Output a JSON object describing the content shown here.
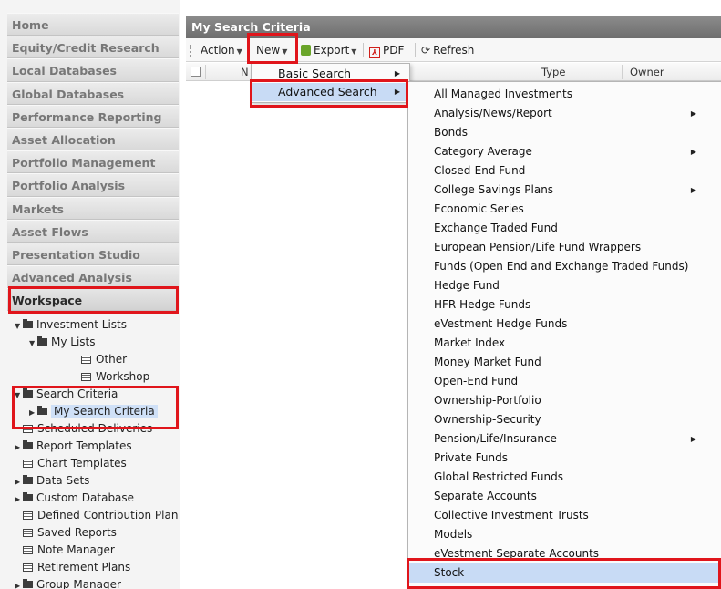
{
  "sidebar": {
    "nav_items": [
      {
        "label": "Home",
        "name": "nav-home"
      },
      {
        "label": "Equity/Credit Research",
        "name": "nav-equity-credit-research"
      },
      {
        "label": "Local Databases",
        "name": "nav-local-databases"
      },
      {
        "label": "Global Databases",
        "name": "nav-global-databases"
      },
      {
        "label": "Performance Reporting",
        "name": "nav-performance-reporting"
      },
      {
        "label": "Asset Allocation",
        "name": "nav-asset-allocation"
      },
      {
        "label": "Portfolio Management",
        "name": "nav-portfolio-management"
      },
      {
        "label": "Portfolio Analysis",
        "name": "nav-portfolio-analysis"
      },
      {
        "label": "Markets",
        "name": "nav-markets"
      },
      {
        "label": "Asset Flows",
        "name": "nav-asset-flows"
      },
      {
        "label": "Presentation Studio",
        "name": "nav-presentation-studio"
      },
      {
        "label": "Advanced Analysis",
        "name": "nav-advanced-analysis"
      },
      {
        "label": "Workspace",
        "name": "nav-workspace",
        "selected": true
      }
    ],
    "tree": [
      {
        "label": "Investment Lists",
        "icon": "folder-icon",
        "arrow": "▼"
      },
      {
        "label": "My Lists",
        "icon": "folder-icon",
        "arrow": "▼"
      },
      {
        "label": "Other",
        "icon": "list-icon",
        "arrow": ""
      },
      {
        "label": "Workshop",
        "icon": "list-icon",
        "arrow": ""
      },
      {
        "label": "Search Criteria",
        "icon": "folder-icon",
        "arrow": "▼"
      },
      {
        "label": "My Search Criteria",
        "icon": "folder-icon",
        "arrow": "▶",
        "selected": true
      },
      {
        "label": "Scheduled Deliveries",
        "icon": "list-icon",
        "arrow": ""
      },
      {
        "label": "Report Templates",
        "icon": "folder-icon",
        "arrow": "▶"
      },
      {
        "label": "Chart Templates",
        "icon": "list-icon",
        "arrow": ""
      },
      {
        "label": "Data Sets",
        "icon": "folder-icon",
        "arrow": "▶"
      },
      {
        "label": "Custom Database",
        "icon": "folder-icon",
        "arrow": "▶"
      },
      {
        "label": "Defined Contribution Plan",
        "icon": "list-icon",
        "arrow": ""
      },
      {
        "label": "Saved Reports",
        "icon": "list-icon",
        "arrow": ""
      },
      {
        "label": "Note Manager",
        "icon": "list-icon",
        "arrow": ""
      },
      {
        "label": "Retirement Plans",
        "icon": "list-icon",
        "arrow": ""
      },
      {
        "label": "Group Manager",
        "icon": "folder-icon",
        "arrow": "▶"
      }
    ]
  },
  "main": {
    "title": "My Search Criteria",
    "toolbar": {
      "action_label": "Action",
      "new_label": "New",
      "export_label": "Export",
      "pdf_label": "PDF",
      "refresh_label": "Refresh"
    },
    "grid": {
      "col_name": "N",
      "col_type": "Type",
      "col_owner": "Owner"
    }
  },
  "new_menu": {
    "items": [
      {
        "label": "Basic Search",
        "has_submenu": true
      },
      {
        "label": "Advanced Search",
        "has_submenu": true,
        "active": true
      }
    ]
  },
  "advanced_search_menu": {
    "items": [
      {
        "label": "All Managed Investments",
        "has_submenu": false
      },
      {
        "label": "Analysis/News/Report",
        "has_submenu": true
      },
      {
        "label": "Bonds",
        "has_submenu": false
      },
      {
        "label": "Category Average",
        "has_submenu": true
      },
      {
        "label": "Closed-End Fund",
        "has_submenu": false
      },
      {
        "label": "College Savings Plans",
        "has_submenu": true
      },
      {
        "label": "Economic Series",
        "has_submenu": false
      },
      {
        "label": "Exchange Traded Fund",
        "has_submenu": false
      },
      {
        "label": "European Pension/Life Fund Wrappers",
        "has_submenu": false
      },
      {
        "label": "Funds (Open End and Exchange Traded Funds)",
        "has_submenu": false
      },
      {
        "label": "Hedge Fund",
        "has_submenu": false
      },
      {
        "label": "HFR Hedge Funds",
        "has_submenu": false
      },
      {
        "label": "eVestment Hedge Funds",
        "has_submenu": false
      },
      {
        "label": "Market Index",
        "has_submenu": false
      },
      {
        "label": "Money Market Fund",
        "has_submenu": false
      },
      {
        "label": "Open-End Fund",
        "has_submenu": false
      },
      {
        "label": "Ownership-Portfolio",
        "has_submenu": false
      },
      {
        "label": "Ownership-Security",
        "has_submenu": false
      },
      {
        "label": "Pension/Life/Insurance",
        "has_submenu": true
      },
      {
        "label": "Private Funds",
        "has_submenu": false
      },
      {
        "label": "Global Restricted Funds",
        "has_submenu": false
      },
      {
        "label": "Separate Accounts",
        "has_submenu": false
      },
      {
        "label": "Collective Investment Trusts",
        "has_submenu": false
      },
      {
        "label": "Models",
        "has_submenu": false
      },
      {
        "label": "eVestment Separate Accounts",
        "has_submenu": false
      },
      {
        "label": "Stock",
        "has_submenu": false,
        "active": true
      }
    ]
  },
  "colors": {
    "highlight_box": "#e0151b",
    "menu_active": "#c8dbf5",
    "title_bar": "#7a7a7a"
  }
}
